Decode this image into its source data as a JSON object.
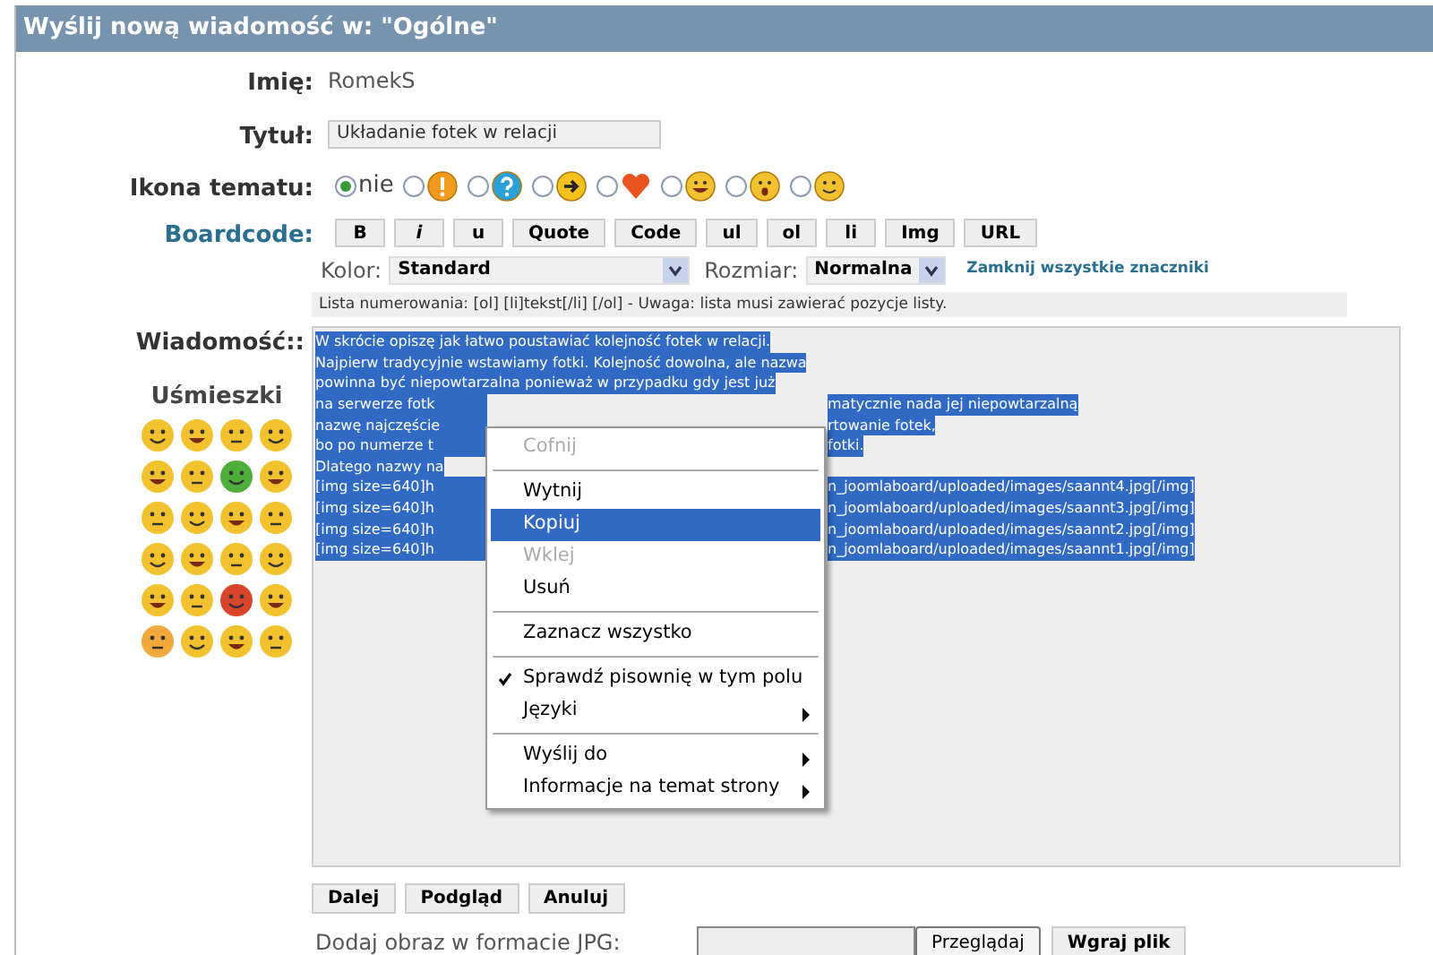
{
  "header": {
    "title": "Wyślij nową wiadomość w: \"Ogólne\""
  },
  "name_row": {
    "label": "Imię:",
    "value": "RomekS"
  },
  "title_row": {
    "label": "Tytuł:",
    "value": "Układanie fotek w relacji"
  },
  "topic_icon": {
    "label": "Ikona tematu:",
    "options": [
      {
        "kind": "none",
        "text": "nie",
        "selected": true
      },
      {
        "kind": "exclamation",
        "selected": false
      },
      {
        "kind": "question",
        "selected": false
      },
      {
        "kind": "arrow",
        "selected": false
      },
      {
        "kind": "heart",
        "selected": false
      },
      {
        "kind": "grin",
        "selected": false
      },
      {
        "kind": "surprised",
        "selected": false
      },
      {
        "kind": "smile",
        "selected": false
      }
    ]
  },
  "boardcode": {
    "label": "Boardcode:",
    "buttons": [
      {
        "text": "B",
        "kind": "plain"
      },
      {
        "text": "i",
        "kind": "italic"
      },
      {
        "text": "u",
        "kind": "plain"
      },
      {
        "text": "Quote",
        "kind": "plain"
      },
      {
        "text": "Code",
        "kind": "plain"
      },
      {
        "text": "ul",
        "kind": "plain"
      },
      {
        "text": "ol",
        "kind": "plain"
      },
      {
        "text": "li",
        "kind": "plain"
      },
      {
        "text": "Img",
        "kind": "plain"
      },
      {
        "text": "URL",
        "kind": "plain"
      }
    ],
    "color_label": "Kolor:",
    "color_value": "Standard",
    "size_label": "Rozmiar:",
    "size_value": "Normalna",
    "close_link": "Zamknij wszystkie znaczniki",
    "hint": "Lista numerowania: [ol] [li]tekst[/li] [/ol] - Uwaga: lista musi zawierać pozycje listy."
  },
  "message": {
    "label": "Wiadomość::",
    "lines": [
      {
        "left": "W skrócie opiszę jak łatwo poustawiać kolejność fotek w relacji."
      },
      {
        "left": "Najpierw tradycyjnie wstawiamy fotki. Kolejność dowolna, ale nazwa"
      },
      {
        "left": "powinna być niepowtarzalna ponieważ w przypadku gdy jest już"
      },
      {
        "left": "na serwerze fotk",
        "right": "matycznie nada jej niepowtarzalną"
      },
      {
        "left": "nazwę najczęście",
        "right": "rtowanie fotek,"
      },
      {
        "left": "bo po numerze t",
        "right": "fotki."
      },
      {
        "left": "Dlatego nazwy na"
      },
      {
        "left": "[img size=640]h",
        "right": "n_joomlaboard/uploaded/images/saannt4.jpg[/img]"
      },
      {
        "left": "[img size=640]h",
        "right": "n_joomlaboard/uploaded/images/saannt3.jpg[/img]"
      },
      {
        "left": "[img size=640]h",
        "right": "n_joomlaboard/uploaded/images/saannt2.jpg[/img]"
      },
      {
        "left": "[img size=640]h",
        "right": "n_joomlaboard/uploaded/images/saannt1.jpg[/img]"
      }
    ]
  },
  "smileys": {
    "title": "Uśmieszki",
    "items": [
      {
        "color": "#f2c12e"
      },
      {
        "color": "#f2c12e"
      },
      {
        "color": "#f2c12e"
      },
      {
        "color": "#f2c12e"
      },
      {
        "color": "#f2c12e"
      },
      {
        "color": "#f2c12e"
      },
      {
        "color": "#4caf3a"
      },
      {
        "color": "#f2c12e"
      },
      {
        "color": "#f2c12e"
      },
      {
        "color": "#f2c12e"
      },
      {
        "color": "#f2c12e"
      },
      {
        "color": "#f2c12e"
      },
      {
        "color": "#f2c12e"
      },
      {
        "color": "#f2c12e"
      },
      {
        "color": "#f2c12e"
      },
      {
        "color": "#f2c12e"
      },
      {
        "color": "#f2c12e"
      },
      {
        "color": "#f2c12e"
      },
      {
        "color": "#d8452b"
      },
      {
        "color": "#f2c12e"
      },
      {
        "color": "#f0a93a"
      },
      {
        "color": "#f2c12e"
      },
      {
        "color": "#f2c12e"
      },
      {
        "color": "#f2c12e"
      }
    ]
  },
  "context_menu": [
    {
      "kind": "item",
      "text": "Cofnij",
      "disabled": true,
      "selected": false,
      "checked": false,
      "submenu": false
    },
    {
      "kind": "separator"
    },
    {
      "kind": "item",
      "text": "Wytnij",
      "disabled": false,
      "selected": false,
      "checked": false,
      "submenu": false
    },
    {
      "kind": "item",
      "text": "Kopiuj",
      "disabled": false,
      "selected": true,
      "checked": false,
      "submenu": false
    },
    {
      "kind": "item",
      "text": "Wklej",
      "disabled": true,
      "selected": false,
      "checked": false,
      "submenu": false
    },
    {
      "kind": "item",
      "text": "Usuń",
      "disabled": false,
      "selected": false,
      "checked": false,
      "submenu": false
    },
    {
      "kind": "separator"
    },
    {
      "kind": "item",
      "text": "Zaznacz wszystko",
      "disabled": false,
      "selected": false,
      "checked": false,
      "submenu": false
    },
    {
      "kind": "separator"
    },
    {
      "kind": "item",
      "text": "Sprawdź pisownię w tym polu",
      "disabled": false,
      "selected": false,
      "checked": true,
      "submenu": false
    },
    {
      "kind": "item",
      "text": "Języki",
      "disabled": false,
      "selected": false,
      "checked": false,
      "submenu": true
    },
    {
      "kind": "separator"
    },
    {
      "kind": "item",
      "text": "Wyślij do",
      "disabled": false,
      "selected": false,
      "checked": false,
      "submenu": true
    },
    {
      "kind": "item",
      "text": "Informacje na temat strony",
      "disabled": false,
      "selected": false,
      "checked": false,
      "submenu": true
    }
  ],
  "actions": [
    "Dalej",
    "Podgląd",
    "Anuluj"
  ],
  "upload": {
    "label": "Dodaj obraz w formacie JPG:",
    "browse": "Przeglądaj",
    "submit": "Wgraj plik"
  }
}
